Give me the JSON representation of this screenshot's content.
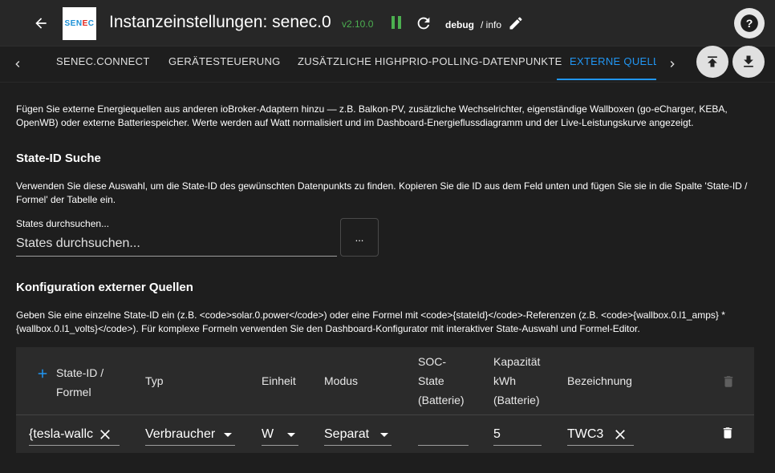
{
  "header": {
    "logo_text_a": "SEN",
    "logo_text_b": "E",
    "logo_text_c": "C",
    "title": "Instanzeinstellungen: senec.0",
    "version": "v2.10.0",
    "log_level": "debug",
    "log_info": "/ info"
  },
  "tabs": [
    {
      "label": "SENEC.CONNECT"
    },
    {
      "label": "GERÄTESTEUERUNG"
    },
    {
      "label": "ZUSÄTZLICHE HIGHPRIO-POLLING-DATENPUNKTE"
    },
    {
      "label": "EXTERNE QUELLEN"
    }
  ],
  "intro": "Fügen Sie externe Energiequellen aus anderen ioBroker-Adaptern hinzu — z.B. Balkon-PV, zusätzliche Wechselrichter, eigenständige Wallboxen (go-eCharger, KEBA, OpenWB) oder externe Batteriespeicher. Werte werden auf Watt normalisiert und im Dashboard-Energieflussdiagramm und der Live-Leistungskurve angezeigt.",
  "state_search": {
    "heading": "State-ID Suche",
    "description": "Verwenden Sie diese Auswahl, um die State-ID des gewünschten Datenpunkts zu finden. Kopieren Sie die ID aus dem Feld unten und fügen Sie sie in die Spalte 'State-ID / Formel' der Tabelle ein.",
    "label": "States durchsuchen...",
    "placeholder": "States durchsuchen...",
    "button": "..."
  },
  "config": {
    "heading": "Konfiguration externer Quellen",
    "description": "Geben Sie eine einzelne State-ID ein (z.B. <code>solar.0.power</code>) oder eine Formel mit <code>{stateId}</code>-Referenzen (z.B. <code>{wallbox.0.l1_amps} * {wallbox.0.l1_volts}</code>). Für komplexe Formeln verwenden Sie den Dashboard-Konfigurator mit interaktiver State-Auswahl und Formel-Editor."
  },
  "table": {
    "columns": {
      "state_id_1": "State-ID /",
      "state_id_2": "Formel",
      "typ": "Typ",
      "einheit": "Einheit",
      "modus": "Modus",
      "soc_1": "SOC-",
      "soc_2": "State",
      "soc_3": "(Batterie)",
      "kap_1": "Kapazität",
      "kap_2": "kWh",
      "kap_3": "(Batterie)",
      "bezeichnung": "Bezeichnung"
    },
    "rows": [
      {
        "state_id": "{tesla-wallc",
        "typ": "Verbraucher",
        "einheit": "W",
        "modus": "Separat",
        "soc": "",
        "kapazitaet": "5",
        "bezeichnung": "TWC3"
      }
    ]
  },
  "colors": {
    "accent": "#2196f3",
    "version": "#4caf50",
    "background": "#1e1e1e",
    "header": "#272727",
    "table": "#2b2b2b"
  }
}
